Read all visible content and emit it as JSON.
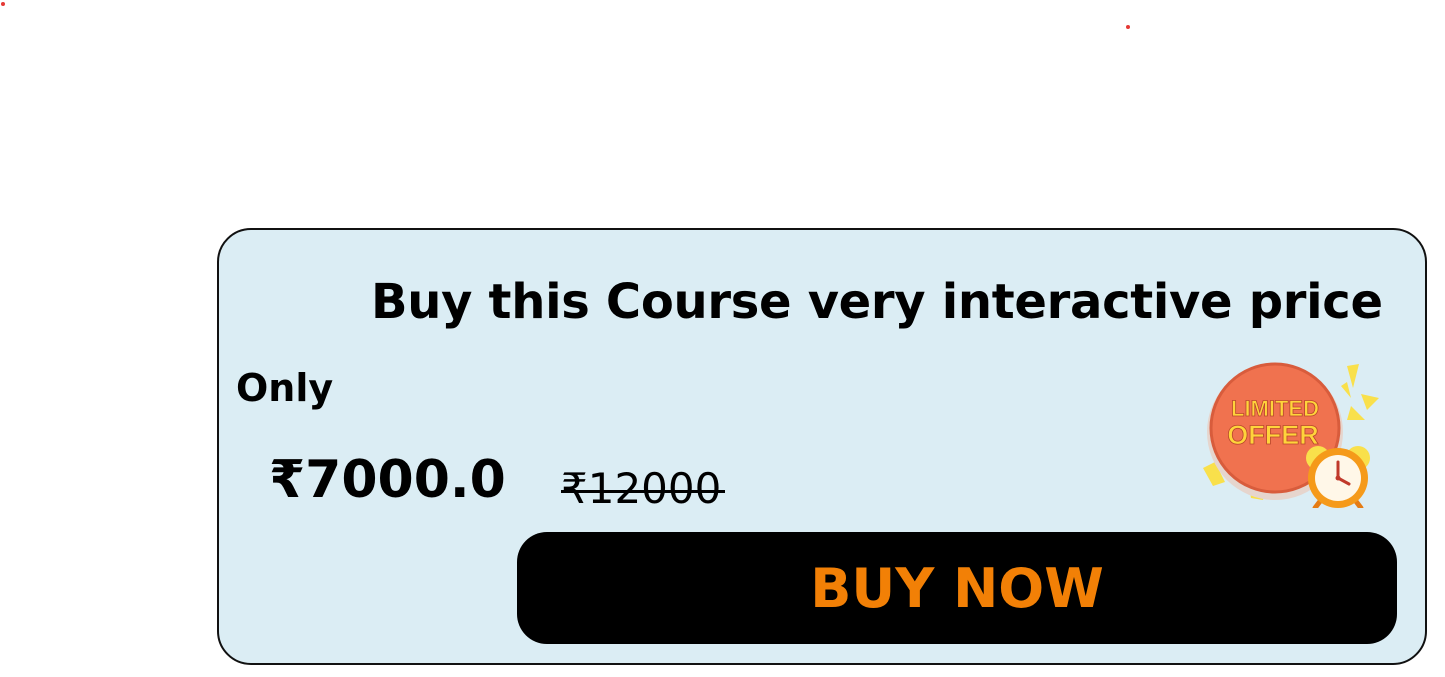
{
  "colors": {
    "card_background": "#dbedf4",
    "card_border": "#111111",
    "button_background": "#000000",
    "button_text": "#f28006",
    "badge_circle": "#f0724f",
    "badge_text": "#ffd43b",
    "confetti": "#f9e04b",
    "stray_dot": "#e53935"
  },
  "offer": {
    "headline": "Buy this Course very interactive price",
    "only_label": "Only",
    "current_price": "₹7000.0",
    "original_price": "₹12000",
    "button_label": "BUY NOW"
  },
  "badge": {
    "line1": "LIMITED",
    "line2": "OFFER",
    "icon": "alarm-clock-icon"
  }
}
